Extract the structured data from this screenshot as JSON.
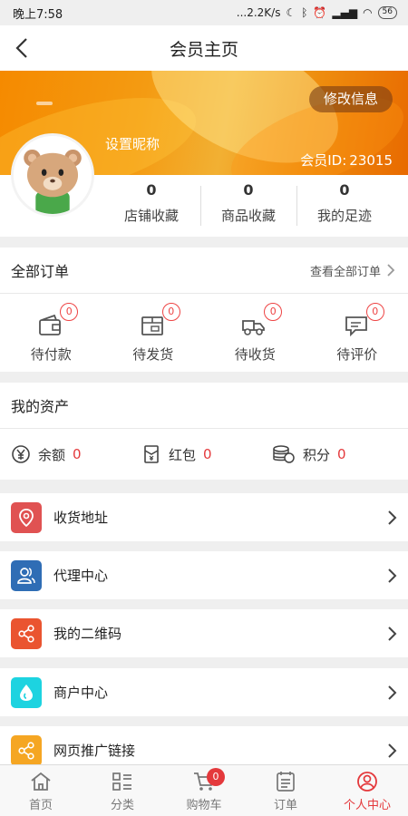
{
  "status_bar": {
    "time": "晚上7:58",
    "network": "...2.2K/s",
    "battery": "56"
  },
  "header": {
    "title": "会员主页"
  },
  "profile": {
    "edit_label": "修改信息",
    "nickname": "设置昵称",
    "member_id_label": "会员ID:",
    "member_id": "23015",
    "stats": [
      {
        "value": "0",
        "label": "店铺收藏"
      },
      {
        "value": "0",
        "label": "商品收藏"
      },
      {
        "value": "0",
        "label": "我的足迹"
      }
    ]
  },
  "orders": {
    "title": "全部订单",
    "view_all": "查看全部订单",
    "items": [
      {
        "label": "待付款",
        "badge": "0",
        "icon": "wallet-icon"
      },
      {
        "label": "待发货",
        "badge": "0",
        "icon": "package-icon"
      },
      {
        "label": "待收货",
        "badge": "0",
        "icon": "truck-icon"
      },
      {
        "label": "待评价",
        "badge": "0",
        "icon": "comment-icon"
      }
    ]
  },
  "assets": {
    "title": "我的资产",
    "items": [
      {
        "label": "余额",
        "value": "0",
        "icon": "yen-icon"
      },
      {
        "label": "红包",
        "value": "0",
        "icon": "red-packet-icon"
      },
      {
        "label": "积分",
        "value": "0",
        "icon": "coins-icon"
      }
    ]
  },
  "menu": [
    {
      "label": "收货地址",
      "icon": "location-icon",
      "color": "#e05252"
    },
    {
      "label": "代理中心",
      "icon": "agent-icon",
      "color": "#2f6db5"
    },
    {
      "label": "我的二维码",
      "icon": "share-icon",
      "color": "#ea5430"
    },
    {
      "label": "商户中心",
      "icon": "drop-icon",
      "color": "#1dd3e0"
    },
    {
      "label": "网页推广链接",
      "icon": "share-icon",
      "color": "#f5a623"
    }
  ],
  "tabbar": {
    "items": [
      {
        "label": "首页",
        "icon": "home-icon"
      },
      {
        "label": "分类",
        "icon": "category-icon"
      },
      {
        "label": "购物车",
        "icon": "cart-icon",
        "badge": "0"
      },
      {
        "label": "订单",
        "icon": "orders-icon"
      },
      {
        "label": "个人中心",
        "icon": "user-icon",
        "active": true
      }
    ]
  },
  "colors": {
    "accent": "#e4393c",
    "banner": "#f49b12"
  }
}
